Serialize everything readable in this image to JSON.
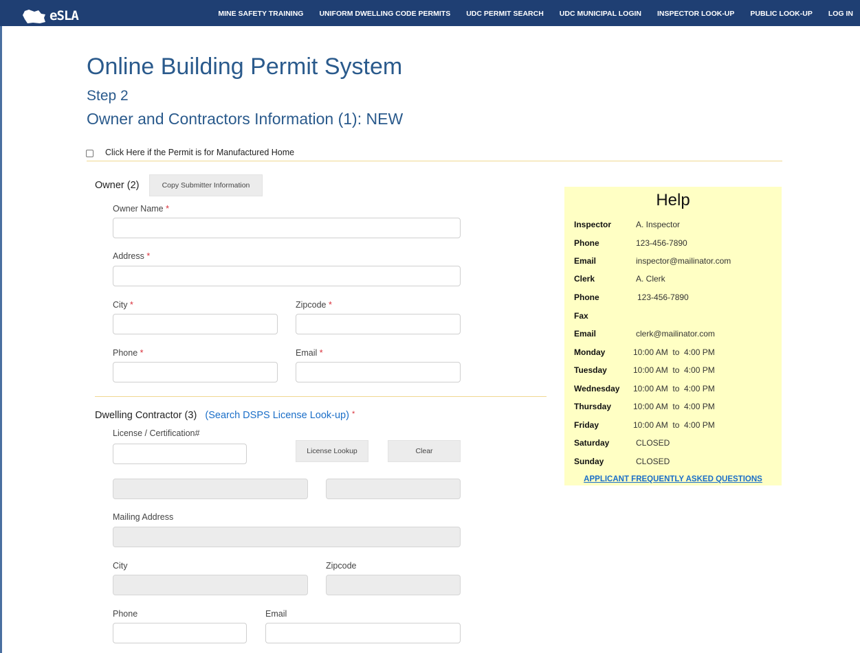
{
  "nav": {
    "logo_text": "eSLA",
    "items": [
      "MINE SAFETY TRAINING",
      "UNIFORM DWELLING CODE PERMITS",
      "UDC PERMIT SEARCH",
      "UDC MUNICIPAL LOGIN",
      "INSPECTOR LOOK-UP",
      "PUBLIC LOOK-UP",
      "LOG IN"
    ]
  },
  "page": {
    "title": "Online Building Permit System",
    "step": "Step 2",
    "subtitle": "Owner and Contractors Information (1): NEW",
    "manufactured_home_label": "Click Here if the Permit is for Manufactured Home"
  },
  "owner": {
    "section_title": "Owner (2)",
    "copy_button": "Copy Submitter Information",
    "owner_name_label": "Owner Name",
    "address_label": "Address",
    "city_label": "City",
    "zipcode_label": "Zipcode",
    "phone_label": "Phone",
    "email_label": "Email",
    "required_mark": "*"
  },
  "contractor": {
    "section_title": "Dwelling Contractor (3)",
    "search_link": "(Search DSPS License Look-up)",
    "required_mark": "*",
    "license_label": "License / Certification#",
    "license_lookup_button": "License Lookup",
    "clear_button": "Clear",
    "mailing_address_label": "Mailing Address",
    "city_label": "City",
    "zipcode_label": "Zipcode",
    "phone_label": "Phone",
    "email_label": "Email"
  },
  "help": {
    "title": "Help",
    "rows": [
      {
        "key": "Inspector",
        "value": "A. Inspector"
      },
      {
        "key": "Phone",
        "value": "123-456-7890"
      },
      {
        "key": "Email",
        "value": "inspector@mailinator.com"
      },
      {
        "key": "Clerk",
        "value": "A. Clerk"
      },
      {
        "key": "Phone",
        "value": "123-456-7890"
      },
      {
        "key": "Fax",
        "value": ""
      },
      {
        "key": "Email",
        "value": "clerk@mailinator.com"
      },
      {
        "key": "Monday",
        "value": "10:00 AM  to  4:00 PM"
      },
      {
        "key": "Tuesday",
        "value": "10:00 AM  to  4:00 PM"
      },
      {
        "key": "Wednesday",
        "value": "10:00 AM  to  4:00 PM"
      },
      {
        "key": "Thursday",
        "value": "10:00 AM  to  4:00 PM"
      },
      {
        "key": "Friday",
        "value": "10:00 AM  to  4:00 PM"
      },
      {
        "key": "Saturday",
        "value": "CLOSED"
      },
      {
        "key": "Sunday",
        "value": "CLOSED"
      }
    ],
    "faq_link": "APPLICANT FREQUENTLY ASKED QUESTIONS"
  },
  "colors": {
    "nav_bg": "#1f3f73",
    "heading": "#2a5a8c",
    "help_bg": "#ffffc4",
    "link": "#1a6ec8",
    "required": "#d9303a"
  }
}
